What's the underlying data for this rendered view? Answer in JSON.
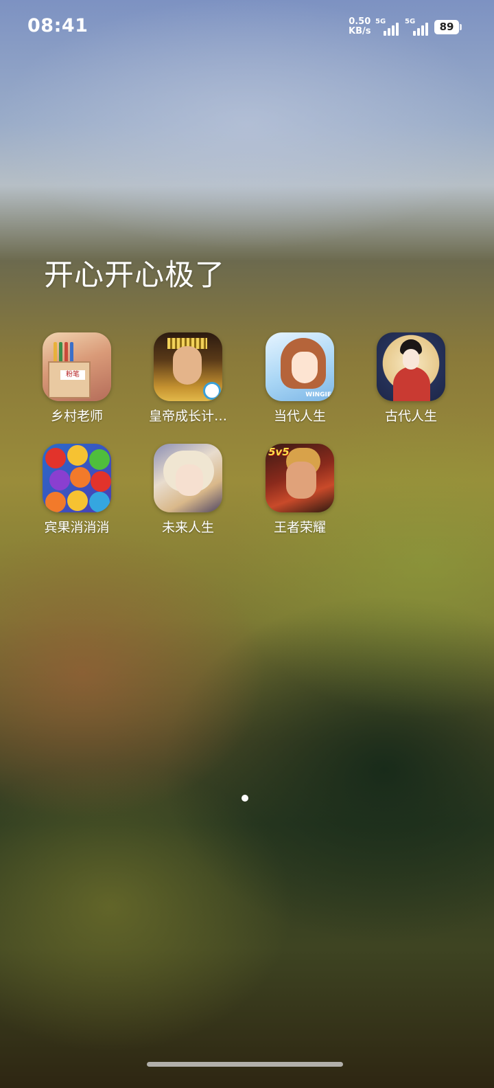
{
  "status_bar": {
    "time": "08:41",
    "net_speed_value": "0.50",
    "net_speed_unit": "KB/s",
    "sim1_tech": "5G",
    "sim2_tech": "5G",
    "battery": "89"
  },
  "folder": {
    "title": "开心开心极了",
    "apps": [
      {
        "label": "乡村老师",
        "icon": "teacher-game-icon",
        "icon_text": "粉笔"
      },
      {
        "label": "皇帝成长计…",
        "icon": "emperor-game-icon"
      },
      {
        "label": "当代人生",
        "icon": "modern-life-game-icon",
        "icon_text": "WINGIE"
      },
      {
        "label": "古代人生",
        "icon": "ancient-life-game-icon"
      },
      {
        "label": "宾果消消消",
        "icon": "candy-match-game-icon"
      },
      {
        "label": "未来人生",
        "icon": "future-life-game-icon"
      },
      {
        "label": "王者荣耀",
        "icon": "honor-of-kings-icon",
        "icon_text": "5v5"
      }
    ]
  },
  "pagination": {
    "current_page": 1,
    "total_pages": 1
  }
}
